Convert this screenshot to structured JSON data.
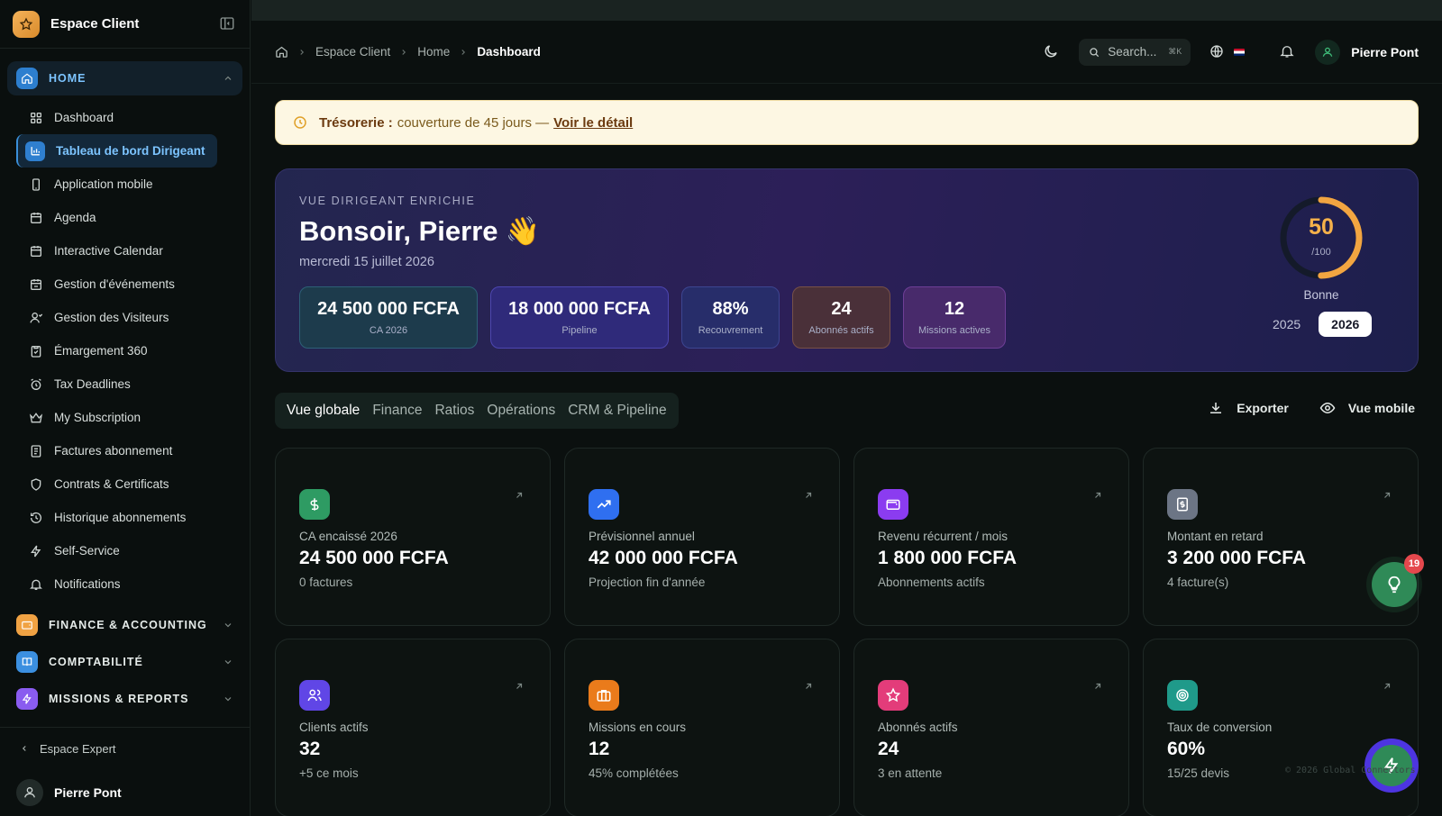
{
  "sidebar": {
    "brand": "Espace Client",
    "home_group": "HOME",
    "items": [
      {
        "label": "Dashboard",
        "icon": "grid-icon"
      },
      {
        "label": "Tableau de bord Dirigeant",
        "icon": "bar-chart-icon",
        "active": true
      },
      {
        "label": "Application mobile",
        "icon": "phone-icon"
      },
      {
        "label": "Agenda",
        "icon": "calendar-icon"
      },
      {
        "label": "Interactive Calendar",
        "icon": "calendar-icon"
      },
      {
        "label": "Gestion d'événements",
        "icon": "calendar-icon"
      },
      {
        "label": "Gestion des Visiteurs",
        "icon": "user-icon"
      },
      {
        "label": "Émargement 360",
        "icon": "clipboard-icon"
      },
      {
        "label": "Tax Deadlines",
        "icon": "alarm-icon"
      },
      {
        "label": "My Subscription",
        "icon": "crown-icon"
      },
      {
        "label": "Factures abonnement",
        "icon": "receipt-icon"
      },
      {
        "label": "Contrats & Certificats",
        "icon": "shield-icon"
      },
      {
        "label": "Historique abonnements",
        "icon": "history-icon"
      },
      {
        "label": "Self-Service",
        "icon": "bolt-icon"
      },
      {
        "label": "Notifications",
        "icon": "bell-icon"
      }
    ],
    "groups": [
      {
        "label": "FINANCE & ACCOUNTING",
        "color": "#f0a243"
      },
      {
        "label": "COMPTABILITÉ",
        "color": "#3b8fe0"
      },
      {
        "label": "MISSIONS & REPORTS",
        "color": "#8a5cf0"
      }
    ],
    "expert_link": "Espace Expert",
    "user_name": "Pierre Pont"
  },
  "header": {
    "breadcrumb": [
      "Espace Client",
      "Home",
      "Dashboard"
    ],
    "search_placeholder": "Search...",
    "search_shortcut": "⌘K",
    "user_name": "Pierre Pont"
  },
  "alert": {
    "title": "Trésorerie :",
    "message": "couverture de 45 jours —",
    "link": "Voir le détail"
  },
  "hero": {
    "kicker": "VUE DIRIGEANT ENRICHIE",
    "greeting": "Bonsoir, Pierre",
    "emoji": "👋",
    "date": "mercredi 15 juillet 2026",
    "kpis": [
      {
        "value": "24 500 000 FCFA",
        "label": "CA 2026"
      },
      {
        "value": "18 000 000 FCFA",
        "label": "Pipeline"
      },
      {
        "value": "88%",
        "label": "Recouvrement"
      },
      {
        "value": "24",
        "label": "Abonnés actifs"
      },
      {
        "value": "12",
        "label": "Missions actives"
      }
    ],
    "score": {
      "value": "50",
      "max": "/100",
      "fraction": 0.5,
      "label": "Bonne"
    },
    "years": [
      "2025",
      "2026"
    ],
    "selected_year": "2026"
  },
  "tabs": [
    "Vue globale",
    "Finance",
    "Ratios",
    "Opérations",
    "CRM & Pipeline"
  ],
  "active_tab": "Vue globale",
  "tools": {
    "export": "Exporter",
    "mobile": "Vue mobile"
  },
  "cards": [
    {
      "label": "CA encaissé 2026",
      "value": "24 500 000 FCFA",
      "sub": "0 factures",
      "icon": "dollar-icon",
      "color": "#2e9b63"
    },
    {
      "label": "Prévisionnel annuel",
      "value": "42 000 000 FCFA",
      "sub": "Projection fin d'année",
      "icon": "trend-up-icon",
      "color": "#2f6ff0"
    },
    {
      "label": "Revenu récurrent / mois",
      "value": "1 800 000 FCFA",
      "sub": "Abonnements actifs",
      "icon": "wallet-icon",
      "color": "#8b3cf0"
    },
    {
      "label": "Montant en retard",
      "value": "3 200 000 FCFA",
      "sub": "4 facture(s)",
      "icon": "invoice-icon",
      "color": "#6c7585"
    },
    {
      "label": "Clients actifs",
      "value": "32",
      "sub": "+5 ce mois",
      "icon": "users-icon",
      "color": "#6046e6"
    },
    {
      "label": "Missions en cours",
      "value": "12",
      "sub": "45% complétées",
      "icon": "briefcase-icon",
      "color": "#ea7b1b"
    },
    {
      "label": "Abonnés actifs",
      "value": "24",
      "sub": "3 en attente",
      "icon": "star-icon",
      "color": "#e33c7a"
    },
    {
      "label": "Taux de conversion",
      "value": "60%",
      "sub": "15/25 devis",
      "icon": "target-icon",
      "color": "#1f9a8a"
    }
  ],
  "notifications_badge": "19",
  "copyright": "© 2026 Global Connectors"
}
